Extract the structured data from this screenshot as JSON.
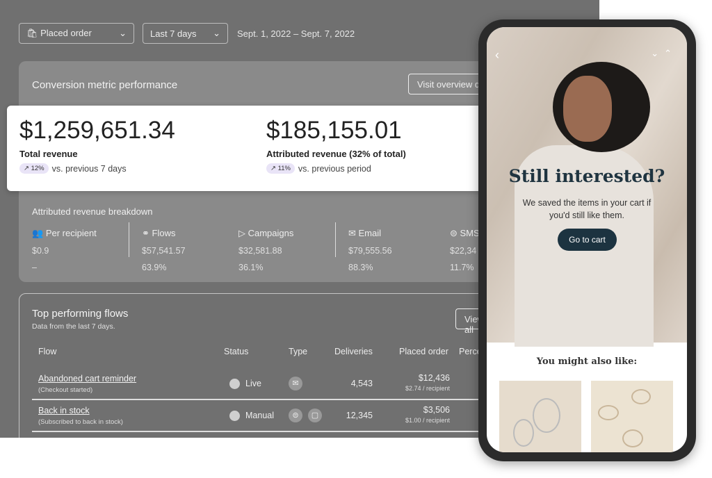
{
  "filters": {
    "metric": "Placed order",
    "range": "Last 7 days",
    "dates": "Sept. 1, 2022 – Sept. 7, 2022"
  },
  "conversion": {
    "title": "Conversion metric performance",
    "visit_button": "Visit overview dashboard",
    "total": {
      "value": "$1,259,651.34",
      "label": "Total revenue",
      "change": "12%",
      "comparison": "vs. previous 7 days"
    },
    "attributed": {
      "value": "$185,155.01",
      "label": "Attributed revenue (32% of total)",
      "change": "11%",
      "comparison": "vs. previous period"
    }
  },
  "breakdown": {
    "title": "Attributed revenue breakdown",
    "columns": [
      {
        "label": "Per recipient",
        "icon": "users-icon",
        "value": "$0.9",
        "pct": "–"
      },
      {
        "label": "Flows",
        "icon": "flows-icon",
        "value": "$57,541.57",
        "pct": "63.9%"
      },
      {
        "label": "Campaigns",
        "icon": "send-icon",
        "value": "$32,581.88",
        "pct": "36.1%"
      },
      {
        "label": "Email",
        "icon": "mail-icon",
        "value": "$79,555.56",
        "pct": "88.3%"
      },
      {
        "label": "SMS",
        "icon": "sms-icon",
        "value": "$22,34",
        "pct": "11.7%"
      }
    ]
  },
  "flows": {
    "title": "Top performing flows",
    "subtitle": "Data from the last 7 days.",
    "view_button": "View all",
    "headers": [
      "Flow",
      "Status",
      "Type",
      "Deliveries",
      "Placed order",
      "Perce"
    ],
    "rows": [
      {
        "name": "Abandoned cart reminder",
        "trigger": "(Checkout started)",
        "status": "Live",
        "types": [
          "mail-icon"
        ],
        "deliveries": "4,543",
        "placed": "$12,436",
        "per": "$2.74 / recipient"
      },
      {
        "name": "Back in stock",
        "trigger": "(Subscribed to back in stock)",
        "status": "Manual",
        "types": [
          "sms-icon",
          "push-icon"
        ],
        "deliveries": "12,345",
        "placed": "$3,506",
        "per": "$1.00 / recipient"
      }
    ]
  },
  "phone": {
    "headline": "Still interested?",
    "body": "We saved the items in your cart if you'd still like them.",
    "cta": "Go to cart",
    "also": "You might also like:"
  },
  "colors": {
    "cta": "#1c3340",
    "badge": "#e9e4f7",
    "panel": "#707070"
  }
}
